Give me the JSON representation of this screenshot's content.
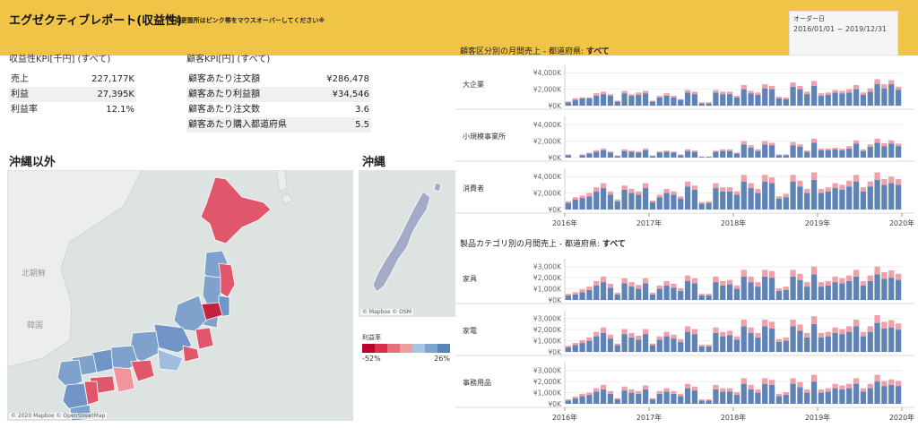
{
  "header": {
    "title": "エグゼクティブレポート(収益性)",
    "note": "※変更箇所はピンク帯をマウスオーバーしてください※",
    "date_filter_label": "オーダー日",
    "date_filter_value": "2016/01/01 ~ 2019/12/31"
  },
  "profit_kpi": {
    "title": "収益性KPI[千円] (すべて)",
    "rows": [
      {
        "label": "売上",
        "value": "227,177K"
      },
      {
        "label": "利益",
        "value": "27,395K"
      },
      {
        "label": "利益率",
        "value": "12.1%"
      }
    ]
  },
  "customer_kpi": {
    "title": "顧客KPI[円] (すべて)",
    "rows": [
      {
        "label": "顧客あたり注文額",
        "value": "¥286,478"
      },
      {
        "label": "顧客あたり利益額",
        "value": "¥34,546"
      },
      {
        "label": "顧客あたり注文数",
        "value": "3.6"
      },
      {
        "label": "顧客あたり購入都道府県",
        "value": "5.5"
      }
    ]
  },
  "map_mainland": {
    "title": "沖縄以外",
    "credit": "© 2020 Mapbox © OpenStreetMap",
    "labels": [
      "北朝鮮",
      "韓国"
    ]
  },
  "map_okinawa": {
    "title": "沖縄",
    "credit": "© Mapbox © OSM"
  },
  "legend": {
    "title": "利益率",
    "min": "-52%",
    "max": "26%",
    "colors": [
      "#b8002a",
      "#d9304a",
      "#e8707a",
      "#eea0a0",
      "#a9c4e0",
      "#7fa3cd",
      "#5b84b8"
    ]
  },
  "colors": {
    "sales": "#6083b5",
    "profit_band": "#f0a0a8",
    "header": "#f0c447"
  },
  "chart_data": [
    {
      "type": "bar",
      "title_prefix": "顧客区分別の月間売上 - 都道府県: ",
      "title_value": "すべて",
      "x_tick_labels": [
        "2016年",
        "2017年",
        "2018年",
        "2019年",
        "2020年"
      ],
      "y_tick_labels": [
        "¥0K",
        "¥2,000K",
        "¥4,000K"
      ],
      "ylim": [
        0,
        5000
      ],
      "stack": [
        "sales",
        "profit"
      ],
      "panels": [
        {
          "name": "大企業",
          "sales": [
            400,
            700,
            900,
            900,
            1200,
            1400,
            1200,
            500,
            1500,
            1200,
            1300,
            1500,
            500,
            1000,
            1200,
            1000,
            700,
            1600,
            1400,
            300,
            300,
            1600,
            1400,
            1400,
            1000,
            2000,
            1500,
            1300,
            2100,
            2000,
            900,
            800,
            2300,
            2000,
            1400,
            2400,
            1200,
            1300,
            1600,
            1500,
            1600,
            2000,
            1300,
            1700,
            2600,
            2100,
            2600,
            1900
          ],
          "profit": [
            100,
            200,
            100,
            100,
            300,
            300,
            200,
            100,
            300,
            200,
            300,
            300,
            100,
            200,
            300,
            200,
            100,
            300,
            300,
            100,
            100,
            300,
            300,
            300,
            200,
            500,
            300,
            300,
            500,
            400,
            200,
            200,
            500,
            400,
            300,
            600,
            300,
            300,
            300,
            300,
            400,
            500,
            300,
            400,
            600,
            500,
            500,
            400
          ]
        },
        {
          "name": "小規模事業所",
          "sales": [
            300,
            0,
            300,
            500,
            700,
            900,
            600,
            200,
            800,
            700,
            600,
            900,
            200,
            600,
            700,
            600,
            300,
            800,
            700,
            100,
            100,
            700,
            800,
            800,
            500,
            1600,
            1200,
            800,
            1600,
            1500,
            300,
            300,
            1500,
            1300,
            700,
            1800,
            900,
            900,
            1000,
            900,
            1100,
            1700,
            800,
            1300,
            1800,
            1400,
            1700,
            1400
          ],
          "profit": [
            80,
            0,
            80,
            100,
            200,
            200,
            150,
            50,
            200,
            150,
            150,
            200,
            50,
            150,
            150,
            150,
            80,
            200,
            150,
            30,
            30,
            150,
            200,
            200,
            100,
            400,
            300,
            200,
            400,
            300,
            80,
            80,
            400,
            300,
            150,
            500,
            200,
            200,
            200,
            200,
            300,
            400,
            200,
            300,
            500,
            350,
            400,
            300
          ]
        },
        {
          "name": "消費者",
          "sales": [
            800,
            1200,
            1400,
            1600,
            2200,
            2600,
            1800,
            1000,
            2400,
            2000,
            1800,
            2600,
            900,
            1500,
            2000,
            1800,
            1300,
            2800,
            2400,
            700,
            800,
            2600,
            2200,
            2200,
            1800,
            3400,
            2600,
            2000,
            3400,
            3200,
            1300,
            1500,
            3400,
            2800,
            2000,
            3600,
            2000,
            2200,
            2600,
            2400,
            2800,
            3400,
            2200,
            2800,
            3600,
            3000,
            3200,
            3000
          ],
          "profit": [
            200,
            300,
            300,
            400,
            500,
            600,
            400,
            200,
            500,
            500,
            400,
            600,
            200,
            300,
            500,
            400,
            300,
            600,
            500,
            200,
            200,
            600,
            500,
            500,
            400,
            800,
            600,
            500,
            800,
            700,
            300,
            400,
            800,
            700,
            500,
            900,
            500,
            500,
            600,
            600,
            700,
            800,
            500,
            600,
            900,
            700,
            800,
            700
          ]
        }
      ]
    },
    {
      "type": "bar",
      "title_prefix": "製品カテゴリ別の月間売上 - 都道府県: ",
      "title_value": "すべて",
      "x_tick_labels": [
        "2016年",
        "2017年",
        "2018年",
        "2019年",
        "2020年"
      ],
      "y_tick_labels": [
        "¥0K",
        "¥1,000K",
        "¥2,000K",
        "¥3,000K"
      ],
      "ylim": [
        0,
        3700
      ],
      "stack": [
        "sales",
        "profit"
      ],
      "panels": [
        {
          "name": "家具",
          "sales": [
            400,
            500,
            700,
            900,
            1300,
            1600,
            1100,
            500,
            1500,
            1200,
            1000,
            1500,
            500,
            1000,
            1300,
            1100,
            800,
            1700,
            1500,
            400,
            400,
            1600,
            1300,
            1400,
            1000,
            2100,
            1600,
            1200,
            2100,
            2000,
            800,
            900,
            2100,
            1800,
            1200,
            2300,
            1200,
            1300,
            1600,
            1500,
            1700,
            2100,
            1300,
            1700,
            2300,
            1900,
            2000,
            1800
          ],
          "profit": [
            150,
            200,
            250,
            300,
            400,
            500,
            350,
            150,
            450,
            400,
            350,
            450,
            150,
            300,
            400,
            350,
            250,
            500,
            450,
            150,
            150,
            500,
            400,
            400,
            300,
            600,
            500,
            400,
            600,
            600,
            250,
            300,
            600,
            550,
            400,
            700,
            400,
            400,
            500,
            450,
            500,
            600,
            400,
            500,
            700,
            600,
            650,
            550
          ]
        },
        {
          "name": "家電",
          "sales": [
            400,
            600,
            800,
            1000,
            1400,
            1700,
            1200,
            600,
            1600,
            1300,
            1100,
            1600,
            600,
            1100,
            1400,
            1200,
            900,
            1800,
            1600,
            500,
            500,
            1700,
            1400,
            1500,
            1100,
            2300,
            1700,
            1300,
            2300,
            2100,
            900,
            1000,
            2300,
            1900,
            1300,
            2500,
            1300,
            1400,
            1700,
            1600,
            1800,
            2300,
            1400,
            1800,
            2600,
            2100,
            2200,
            2000
          ],
          "profit": [
            150,
            200,
            250,
            300,
            400,
            500,
            350,
            150,
            450,
            400,
            350,
            450,
            150,
            300,
            400,
            350,
            250,
            500,
            450,
            150,
            150,
            500,
            400,
            400,
            300,
            600,
            500,
            400,
            600,
            600,
            250,
            300,
            600,
            550,
            400,
            700,
            400,
            400,
            500,
            450,
            500,
            600,
            400,
            500,
            700,
            600,
            650,
            550
          ]
        },
        {
          "name": "事務用品",
          "sales": [
            300,
            500,
            700,
            800,
            1100,
            1300,
            900,
            400,
            1200,
            1000,
            900,
            1300,
            400,
            900,
            1100,
            900,
            700,
            1400,
            1200,
            300,
            300,
            1300,
            1100,
            1100,
            800,
            1800,
            1300,
            1000,
            1800,
            1700,
            700,
            800,
            1800,
            1500,
            1000,
            2000,
            1000,
            1100,
            1400,
            1300,
            1400,
            1800,
            1100,
            1400,
            2000,
            1600,
            1700,
            1600
          ],
          "profit": [
            100,
            150,
            200,
            200,
            300,
            400,
            250,
            100,
            350,
            300,
            250,
            350,
            100,
            250,
            300,
            250,
            200,
            400,
            350,
            100,
            100,
            400,
            300,
            300,
            250,
            500,
            400,
            300,
            500,
            450,
            200,
            250,
            500,
            450,
            300,
            600,
            300,
            300,
            400,
            350,
            400,
            500,
            300,
            400,
            600,
            450,
            500,
            450
          ]
        }
      ]
    }
  ]
}
